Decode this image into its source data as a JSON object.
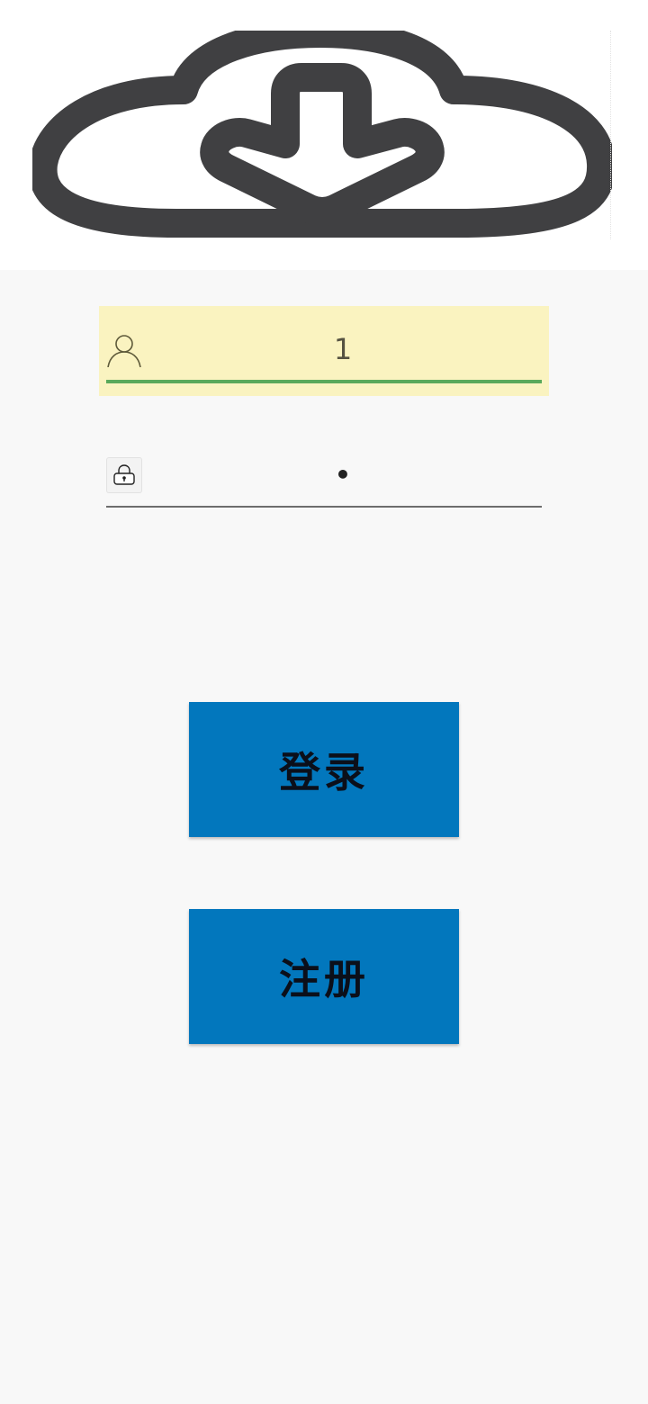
{
  "header": {
    "logo_icon": "cloud-download-icon"
  },
  "form": {
    "username": {
      "value": "1",
      "icon": "user-icon",
      "focused_highlight_color": "#faf3c0",
      "underline_color": "#5aa95b"
    },
    "password": {
      "value": "•",
      "icon": "lock-icon",
      "underline_color": "#6d6d6d"
    }
  },
  "buttons": {
    "login_label": "登录",
    "register_label": "注册",
    "color": "#0277bd"
  },
  "colors": {
    "background": "#f8f8f8",
    "header_background": "#ffffff",
    "logo": "#404042"
  }
}
